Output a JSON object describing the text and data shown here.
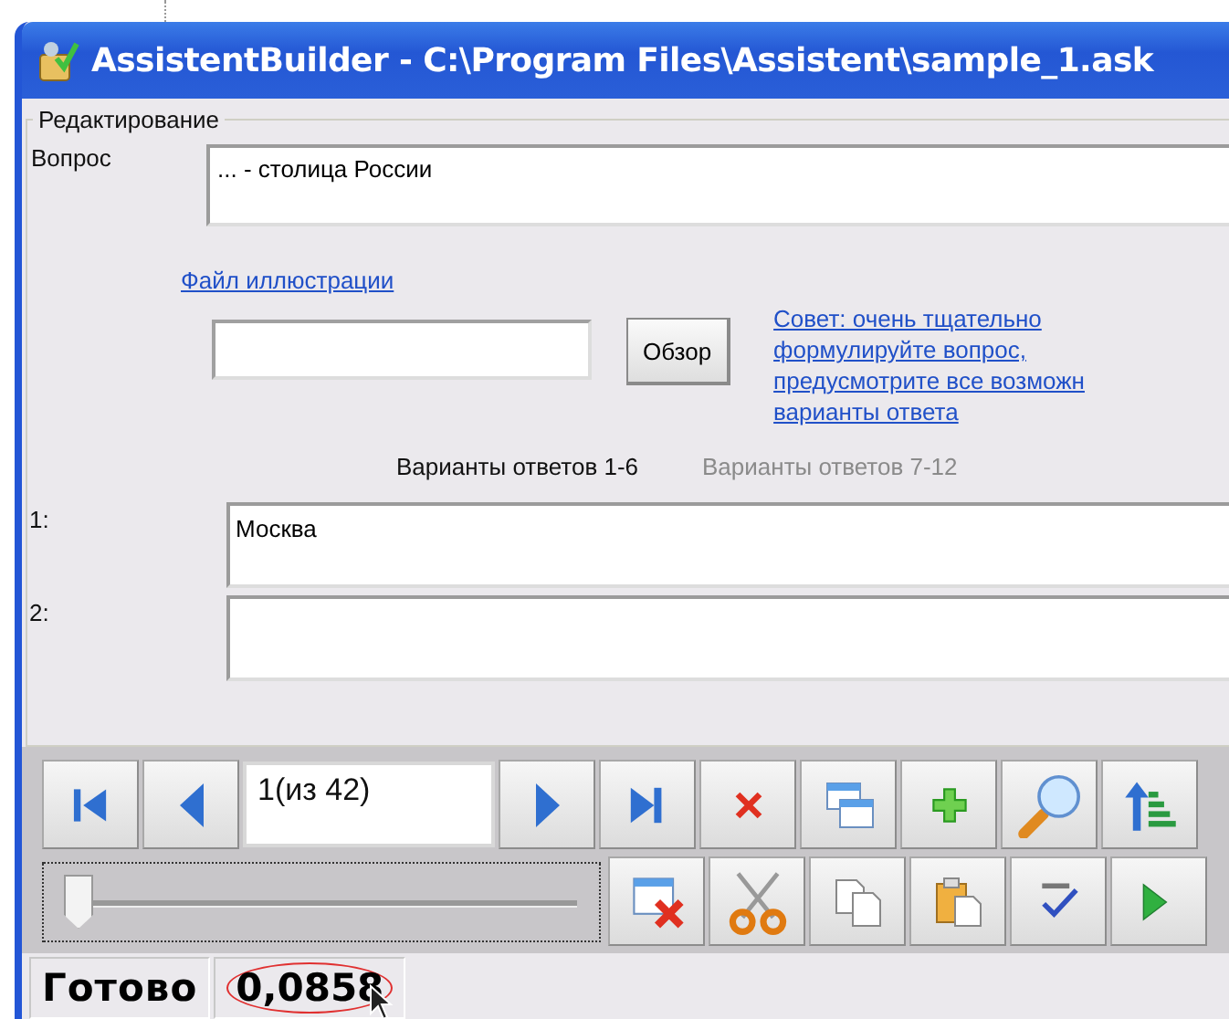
{
  "window": {
    "title": "AssistentBuilder - C:\\Program Files\\Assistent\\sample_1.ask"
  },
  "group": {
    "title": "Редактирование"
  },
  "question": {
    "label": "Вопрос",
    "value": "...  - столица России"
  },
  "illustration": {
    "link": "Файл иллюстрации",
    "browse_button": "Обзор",
    "tip": [
      "Совет: очень тщательно",
      "формулируйте вопрос,",
      "предусмотрите все возможн",
      "варианты ответа"
    ]
  },
  "tabs": [
    {
      "label": "Варианты ответов 1-6",
      "selected": true
    },
    {
      "label": "Варианты ответов 7-12",
      "selected": false
    }
  ],
  "answers": [
    {
      "label": "1:",
      "value": "Москва"
    },
    {
      "label": "2:"
    }
  ],
  "toolbar": {
    "row1": [
      {
        "kind": "first"
      },
      {
        "kind": "prev"
      },
      {
        "kind": "record",
        "value": "1(из 42)"
      },
      {
        "kind": "next"
      },
      {
        "kind": "last"
      },
      {
        "kind": "delete"
      },
      {
        "kind": "windows"
      },
      {
        "kind": "add"
      },
      {
        "kind": "search"
      },
      {
        "kind": "sort"
      }
    ],
    "row2": [
      {
        "kind": "slider",
        "level": 0
      },
      {
        "kind": "close-window"
      },
      {
        "kind": "cut"
      },
      {
        "kind": "copy"
      },
      {
        "kind": "paste"
      },
      {
        "kind": "spellcheck"
      },
      {
        "kind": "run"
      }
    ]
  },
  "status_bar": {
    "state": "Готово",
    "value": "0,0858",
    "highlighted": true
  }
}
